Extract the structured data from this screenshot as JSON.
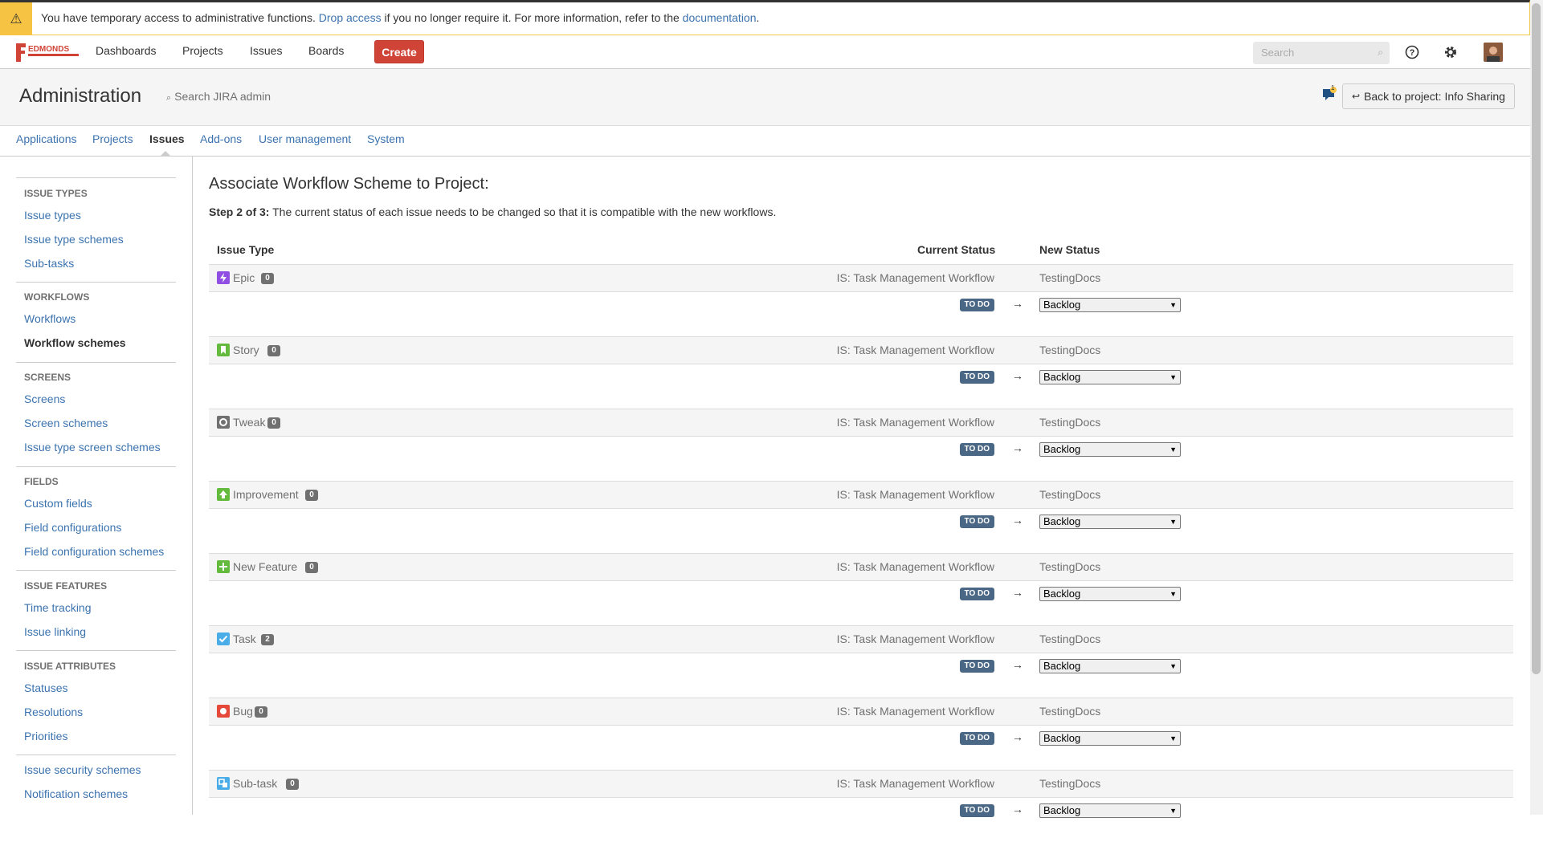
{
  "banner": {
    "text_before": "You have temporary access to administrative functions. ",
    "drop_access": "Drop access",
    "text_middle": " if you no longer require it. For more information, refer to the ",
    "documentation": "documentation",
    "text_after": "."
  },
  "header": {
    "logo_text": "EDMONDS",
    "nav": [
      "Dashboards",
      "Projects",
      "Issues",
      "Boards"
    ],
    "create": "Create",
    "search_placeholder": "Search"
  },
  "admin": {
    "title": "Administration",
    "search": "Search JIRA admin",
    "notification_count": "1",
    "back_button": "Back to project: Info Sharing"
  },
  "tabs": [
    "Applications",
    "Projects",
    "Issues",
    "Add-ons",
    "User management",
    "System"
  ],
  "sidebar": {
    "sections": [
      {
        "heading": "ISSUE TYPES",
        "items": [
          "Issue types",
          "Issue type schemes",
          "Sub-tasks"
        ]
      },
      {
        "heading": "WORKFLOWS",
        "items": [
          "Workflows",
          "Workflow schemes"
        ]
      },
      {
        "heading": "SCREENS",
        "items": [
          "Screens",
          "Screen schemes",
          "Issue type screen schemes"
        ]
      },
      {
        "heading": "FIELDS",
        "items": [
          "Custom fields",
          "Field configurations",
          "Field configuration schemes"
        ]
      },
      {
        "heading": "ISSUE FEATURES",
        "items": [
          "Time tracking",
          "Issue linking"
        ]
      },
      {
        "heading": "ISSUE ATTRIBUTES",
        "items": [
          "Statuses",
          "Resolutions",
          "Priorities"
        ]
      },
      {
        "heading": "",
        "items": [
          "Issue security schemes",
          "Notification schemes"
        ]
      }
    ]
  },
  "main": {
    "title": "Associate Workflow Scheme to Project:",
    "step_label": "Step 2 of 3:",
    "step_text": " The current status of each issue needs to be changed so that it is compatible with the new workflows.",
    "columns": {
      "issue_type": "Issue Type",
      "current_status": "Current Status",
      "new_status": "New Status"
    },
    "rows": [
      {
        "type": "Epic",
        "count": "0",
        "current": "IS: Task Management Workflow",
        "new": "TestingDocs",
        "status": "TO DO",
        "arrow": "→",
        "select": "Backlog",
        "icon": "epic-icon",
        "color": "#904ee2"
      },
      {
        "type": "Story",
        "count": "0",
        "current": "IS: Task Management Workflow",
        "new": "TestingDocs",
        "status": "TO DO",
        "arrow": "→",
        "select": "Backlog",
        "icon": "story-icon",
        "color": "#63ba3c"
      },
      {
        "type": "Tweak",
        "count": "0",
        "current": "IS: Task Management Workflow",
        "new": "TestingDocs",
        "status": "TO DO",
        "arrow": "→",
        "select": "Backlog",
        "icon": "tweak-icon",
        "color": "#707070"
      },
      {
        "type": "Improvement",
        "count": "0",
        "current": "IS: Task Management Workflow",
        "new": "TestingDocs",
        "status": "TO DO",
        "arrow": "→",
        "select": "Backlog",
        "icon": "improvement-icon",
        "color": "#63ba3c"
      },
      {
        "type": "New Feature",
        "count": "0",
        "current": "IS: Task Management Workflow",
        "new": "TestingDocs",
        "status": "TO DO",
        "arrow": "→",
        "select": "Backlog",
        "icon": "new-feature-icon",
        "color": "#63ba3c"
      },
      {
        "type": "Task",
        "count": "2",
        "current": "IS: Task Management Workflow",
        "new": "TestingDocs",
        "status": "TO DO",
        "arrow": "→",
        "select": "Backlog",
        "icon": "task-icon",
        "color": "#4bade8"
      },
      {
        "type": "Bug",
        "count": "0",
        "current": "IS: Task Management Workflow",
        "new": "TestingDocs",
        "status": "TO DO",
        "arrow": "→",
        "select": "Backlog",
        "icon": "bug-icon",
        "color": "#e5493a"
      },
      {
        "type": "Sub-task",
        "count": "0",
        "current": "IS: Task Management Workflow",
        "new": "TestingDocs",
        "status": "TO DO",
        "arrow": "→",
        "select": "Backlog",
        "icon": "subtask-icon",
        "color": "#4bade8"
      }
    ]
  },
  "colors": {
    "link": "#3b73af",
    "create": "#d04437",
    "banner": "#f6c342",
    "lozenge": "#4a6785"
  }
}
